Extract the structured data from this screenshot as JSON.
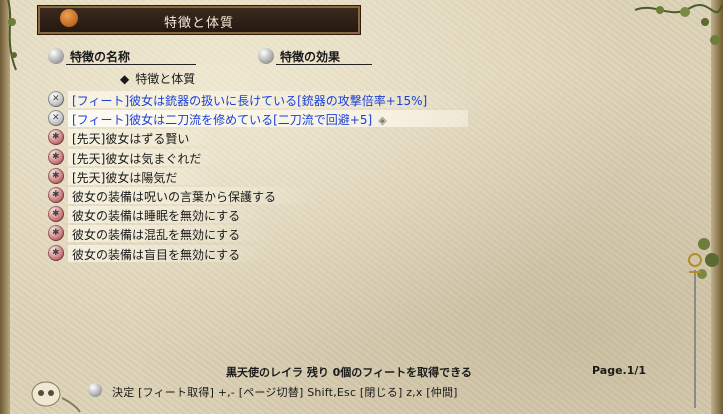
{
  "window": {
    "title": "特徴と体質"
  },
  "columns": {
    "name_label": "特徴の名称",
    "effect_label": "特徴の効果"
  },
  "section": {
    "heading": "特徴と体質",
    "bullet": "◆"
  },
  "features": [
    {
      "text": "[フィート]彼女は銃器の扱いに長けている[銃器の攻撃倍率+15%]",
      "kind": "feat",
      "color": "#1a3fd6",
      "selected": false
    },
    {
      "text": "[フィート]彼女は二刀流を修めている[二刀流で回避+5]",
      "kind": "feat",
      "color": "#1a3fd6",
      "selected": true
    },
    {
      "text": "[先天]彼女はずる賢い",
      "kind": "fixed",
      "color": "#1a1a1a",
      "selected": false
    },
    {
      "text": "[先天]彼女は気まぐれだ",
      "kind": "fixed",
      "color": "#1a1a1a",
      "selected": false
    },
    {
      "text": "[先天]彼女は陽気だ",
      "kind": "fixed",
      "color": "#1a1a1a",
      "selected": false
    },
    {
      "text": "彼女の装備は呪いの言葉から保護する",
      "kind": "fixed",
      "color": "#1a1a1a",
      "selected": false
    },
    {
      "text": "彼女の装備は睡眠を無効にする",
      "kind": "fixed",
      "color": "#1a1a1a",
      "selected": false
    },
    {
      "text": "彼女の装備は混乱を無効にする",
      "kind": "fixed",
      "color": "#1a1a1a",
      "selected": false
    },
    {
      "text": "彼女の装備は盲目を無効にする",
      "kind": "fixed",
      "color": "#1a1a1a",
      "selected": false
    }
  ],
  "selected_marker": "◈",
  "status": {
    "text": "黒天使のレイラ 残り 0個のフィートを取得できる",
    "page": "Page.1/1"
  },
  "hint": "決定 [フィート取得]  +,- [ページ切替]  Shift,Esc [閉じる]  z,x [仲間]"
}
